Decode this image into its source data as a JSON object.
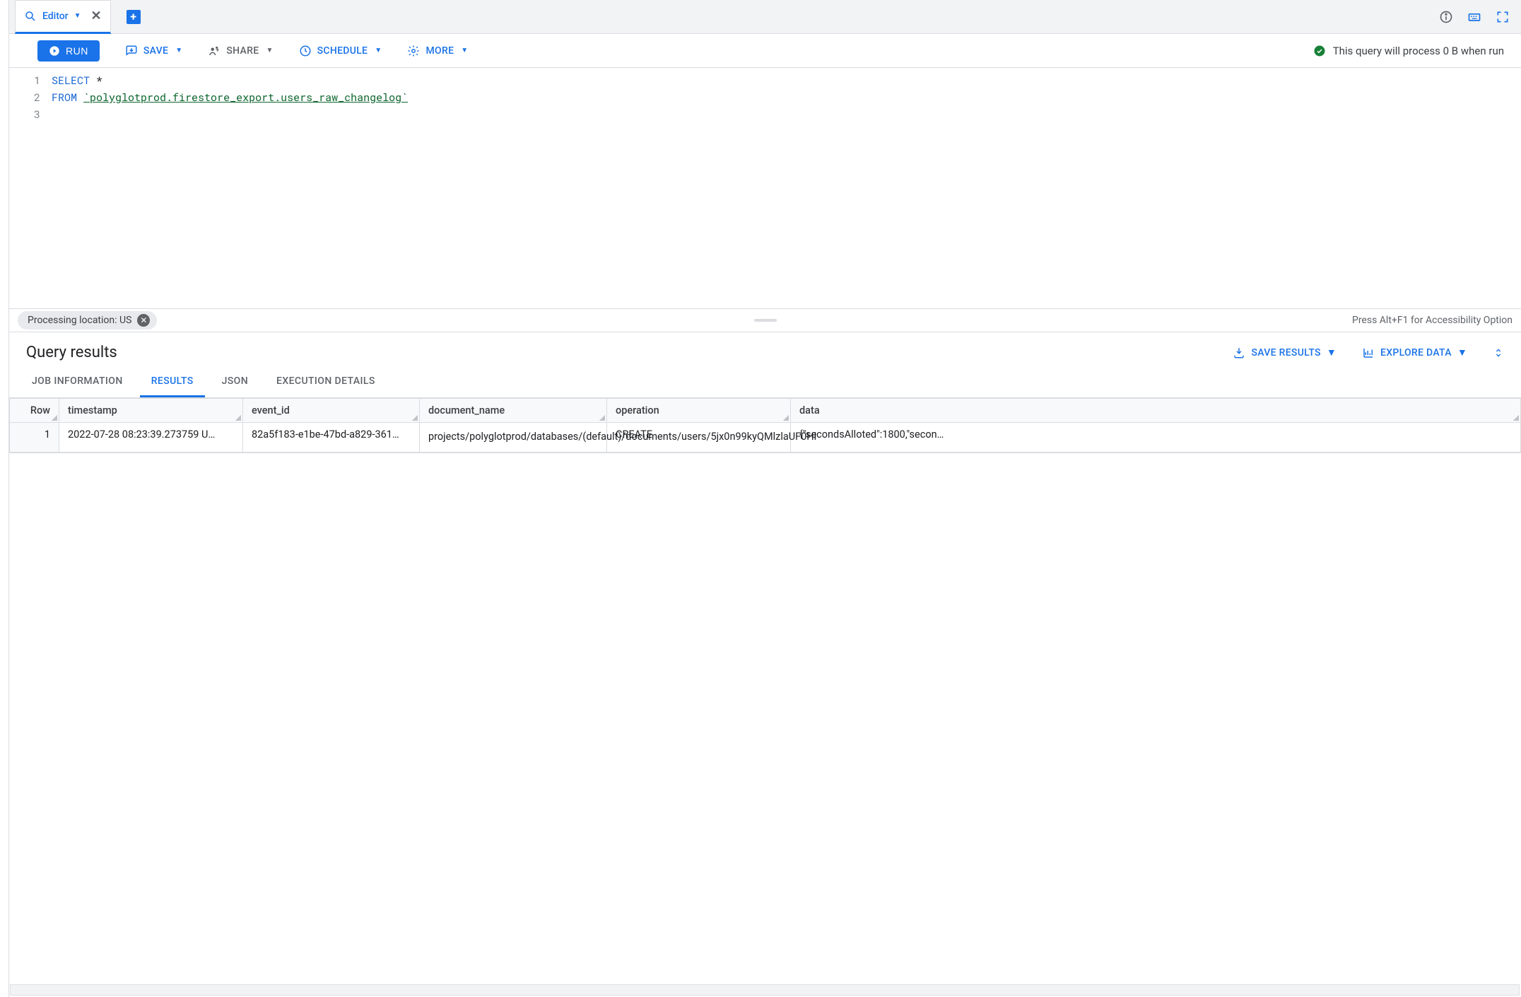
{
  "tab": {
    "label": "Editor"
  },
  "toolbar": {
    "run": "RUN",
    "save": "SAVE",
    "share": "SHARE",
    "schedule": "SCHEDULE",
    "more": "MORE",
    "process_msg": "This query will process 0 B when run"
  },
  "editor": {
    "lines": [
      "1",
      "2",
      "3"
    ],
    "kw_select": "SELECT",
    "star": " *",
    "kw_from": "FROM",
    "table_ref": "`polyglotprod.firestore_export.users_raw_changelog`"
  },
  "chip": {
    "label": "Processing location: US"
  },
  "accessibility_hint": "Press Alt+F1 for Accessibility Option",
  "results": {
    "title": "Query results",
    "save_results": "SAVE RESULTS",
    "explore_data": "EXPLORE DATA",
    "tabs": {
      "job_info": "JOB INFORMATION",
      "results": "RESULTS",
      "json": "JSON",
      "exec": "EXECUTION DETAILS"
    },
    "columns": {
      "row": "Row",
      "timestamp": "timestamp",
      "event_id": "event_id",
      "document_name": "document_name",
      "operation": "operation",
      "data": "data"
    },
    "rows": [
      {
        "n": "1",
        "timestamp": "2022-07-28 08:23:39.273759 U…",
        "event_id": "82a5f183-e1be-47bd-a829-361…",
        "document_name": "projects/polyglotprod/databases/(default)/documents/users/5jx0n99kyQMlzlaUF0Hl",
        "operation": "CREATE",
        "data": "{\"secondsAlloted\":1800,\"secon…"
      }
    ]
  }
}
